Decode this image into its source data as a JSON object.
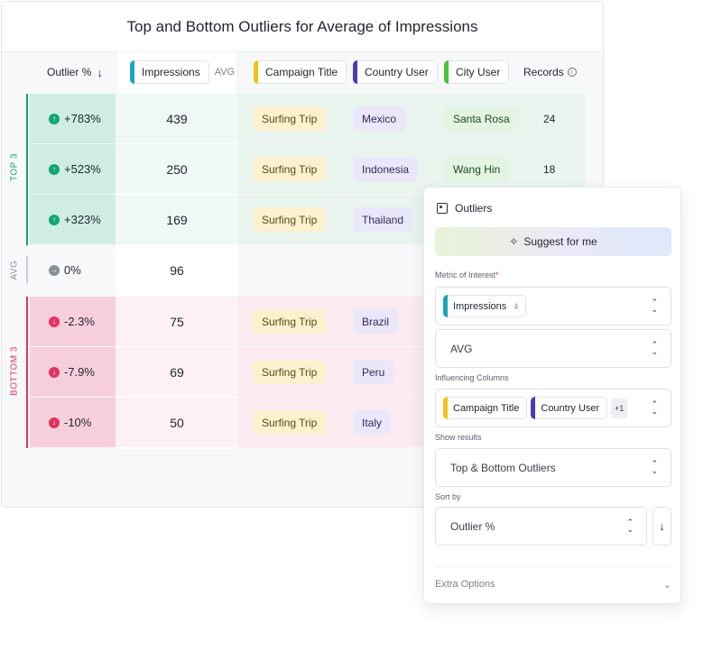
{
  "table": {
    "title": "Top and Bottom Outliers for Average of Impressions",
    "headers": {
      "outlier": "Outlier %",
      "impressions": "Impressions",
      "impressions_agg": "AVG",
      "campaign": "Campaign Title",
      "country": "Country User",
      "city": "City User",
      "records": "Records"
    },
    "group_top": "TOP 3",
    "group_avg": "AVG",
    "group_bottom": "BOTTOM 3",
    "rows": [
      {
        "outlier": "+783%",
        "impressions": "439",
        "campaign": "Surfing Trip",
        "country": "Mexico",
        "city": "Santa Rosa",
        "records": "24"
      },
      {
        "outlier": "+523%",
        "impressions": "250",
        "campaign": "Surfing Trip",
        "country": "Indonesia",
        "city": "Wang Hin",
        "records": "18"
      },
      {
        "outlier": "+323%",
        "impressions": "169",
        "campaign": "Surfing Trip",
        "country": "Thailand",
        "city": "",
        "records": ""
      },
      {
        "outlier": "0%",
        "impressions": "96",
        "campaign": "",
        "country": "",
        "city": "",
        "records": ""
      },
      {
        "outlier": "-2.3%",
        "impressions": "75",
        "campaign": "Surfing Trip",
        "country": "Brazil",
        "city": "",
        "records": ""
      },
      {
        "outlier": "-7.9%",
        "impressions": "69",
        "campaign": "Surfing Trip",
        "country": "Peru",
        "city": "",
        "records": ""
      },
      {
        "outlier": "-10%",
        "impressions": "50",
        "campaign": "Surfing Trip",
        "country": "Italy",
        "city": "",
        "records": ""
      }
    ]
  },
  "panel": {
    "title": "Outliers",
    "suggest_label": "Suggest for me",
    "metric_label": "Metric of Interest",
    "metric_required": "*",
    "metric_value": "Impressions",
    "metric_count": "4",
    "aggregation_value": "AVG",
    "influencing_label": "Influencing Columns",
    "influencing": [
      "Campaign Title",
      "Country User"
    ],
    "influencing_more": "+1",
    "show_results_label": "Show results",
    "show_results_value": "Top & Bottom Outliers",
    "sort_by_label": "Sort by",
    "sort_by_value": "Outlier %",
    "extra_options_label": "Extra Options"
  },
  "colors": {
    "impressions_accent": "#1aa6b8",
    "campaign_accent": "#f2c21b",
    "country_accent": "#4b3bb8",
    "city_accent": "#4ac23a",
    "top_green": "#12a574",
    "bottom_pink": "#e0345e",
    "avg_gray": "#8a8f9c"
  },
  "icons": {
    "sort": "arrow-down-icon",
    "info": "info-icon",
    "up": "arrow-up-circle-icon",
    "down": "arrow-down-circle-icon",
    "neutral": "arrow-right-circle-icon",
    "panel": "outliers-icon",
    "wand": "magic-wand-icon",
    "updown": "chevron-up-down-icon",
    "expand": "chevron-down-icon"
  }
}
